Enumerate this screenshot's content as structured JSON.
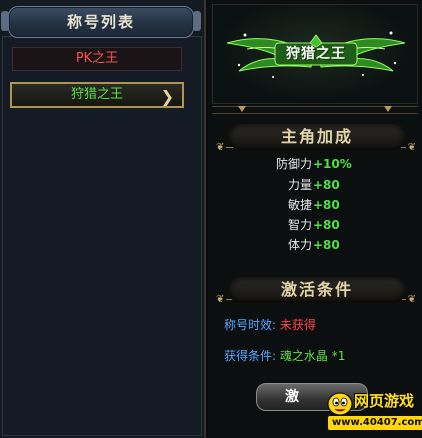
{
  "left_panel": {
    "title": "称号列表",
    "items": [
      {
        "label": "PK之王",
        "color": "#ff4c4c",
        "selected": false
      },
      {
        "label": "狩猎之王",
        "color": "#5fe04b",
        "selected": true
      }
    ],
    "chevron_icon": "chevron-right-icon"
  },
  "right_panel": {
    "banner": {
      "title": "狩猎之王",
      "emblem_icon": "green-wings-icon"
    },
    "bonus_section": {
      "heading": "主角加成",
      "stats": [
        {
          "label": "防御力",
          "value": "+10%"
        },
        {
          "label": "力量",
          "value": "+80"
        },
        {
          "label": "敏捷",
          "value": "+80"
        },
        {
          "label": "智力",
          "value": "+80"
        },
        {
          "label": "体力",
          "value": "+80"
        }
      ]
    },
    "condition_section": {
      "heading": "激活条件",
      "validity_label": "称号时效:",
      "validity_value": "未获得",
      "requirement_label": "获得条件:",
      "requirement_value": "魂之水晶 *1"
    },
    "activate_button": {
      "label": "激"
    }
  },
  "watermark": {
    "title": "网页游戏",
    "url": "www.40407.com"
  },
  "colors": {
    "gold": "#b09552",
    "green": "#4ee044",
    "red": "#ff4646",
    "blue": "#58a6ff"
  }
}
